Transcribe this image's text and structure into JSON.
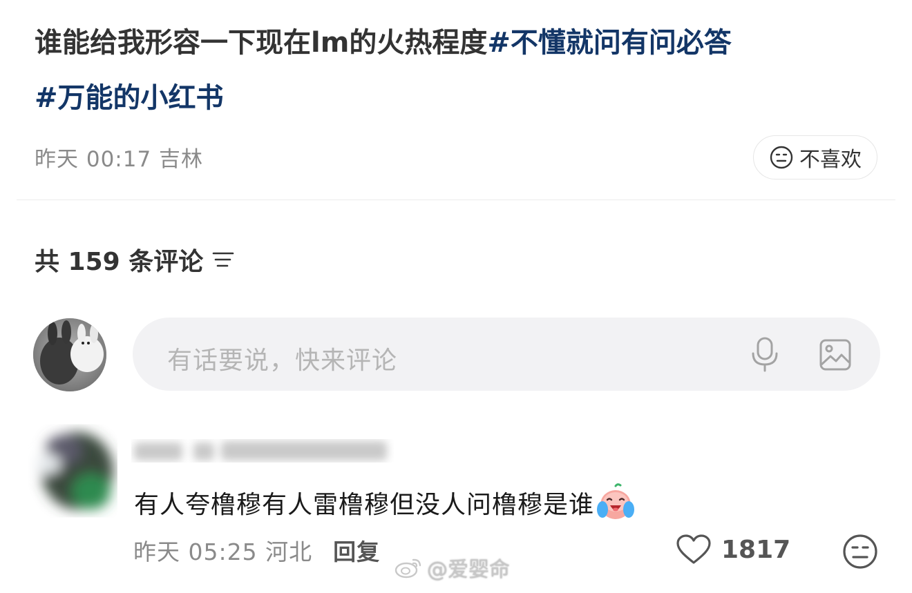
{
  "post": {
    "title_text": "谁能给我形容一下现在lm的火热程度",
    "hashtag_1": "#不懂就问有问必答",
    "hashtag_2": "#万能的小红书",
    "meta": "昨天 00:17 吉林",
    "dislike_label": "不喜欢"
  },
  "comments_header": {
    "label": "共 159 条评论"
  },
  "comment_input": {
    "placeholder": "有话要说，快来评论"
  },
  "comment": {
    "text": "有人夸橹穆有人雷橹穆但没人问橹穆是谁",
    "time_location": "昨天 05:25 河北",
    "reply_label": "回复",
    "like_count": "1817"
  },
  "watermark": {
    "text": "@爱婴命"
  },
  "icons": {
    "dislike": "meh-face-icon",
    "sort": "sort-lines-icon",
    "mic": "microphone-icon",
    "image": "image-icon",
    "like": "heart-outline-icon",
    "emoji": "crying-laugh-emoji-icon"
  },
  "colors": {
    "hashtag": "#133667",
    "input_bg": "#f2f2f4",
    "muted_text": "#8a8a8a"
  }
}
